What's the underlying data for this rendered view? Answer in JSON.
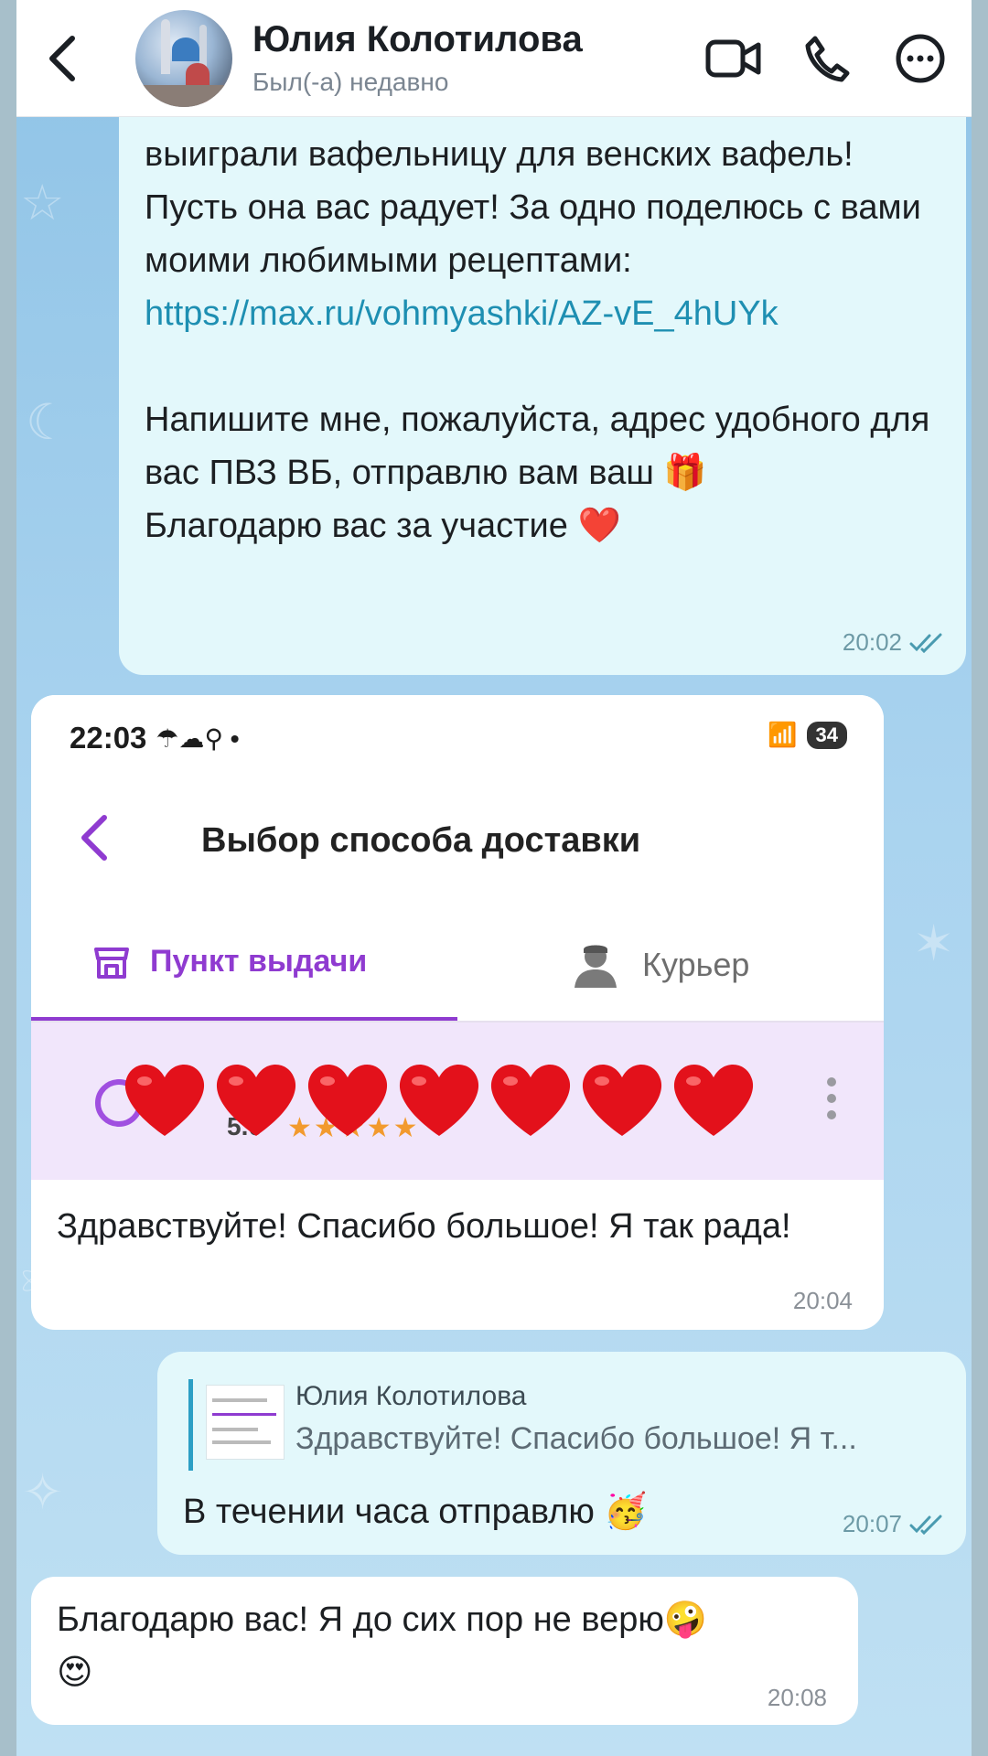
{
  "header": {
    "contact_name": "Юлия Колотилова",
    "status": "Был(-а) недавно"
  },
  "messages": {
    "m1": {
      "text_before_link": "выиграли вафельницу для венских вафель! Пусть она вас радует! За одно поделюсь с вами моими любимыми рецептами: ",
      "link": "https://max.ru/vohmyashki/AZ-vE_4hUYk",
      "text_after": "\n\nНапишите мне, пожалуйста, адрес удобного для вас ПВЗ ВБ, отправлю вам ваш 🎁\nБлагодарю вас за участие ❤️",
      "time": "20:02"
    },
    "m2": {
      "screenshot": {
        "status_time": "22:03",
        "battery": "34",
        "title": "Выбор способа доставки",
        "tab_pickup": "Пункт выдачи",
        "tab_courier": "Курьер",
        "rating": "5.0",
        "stars": "★★★★★"
      },
      "text": "Здравствуйте! Спасибо большое! Я так рада!",
      "time": "20:04"
    },
    "m3": {
      "reply_name": "Юлия Колотилова",
      "reply_text": "Здравствуйте! Спасибо большое! Я т...",
      "text": "В течении часа отправлю 🥳",
      "time": "20:07"
    },
    "m4": {
      "text": "Благодарю вас! Я до сих пор не верю🤪\n😍",
      "time": "20:08"
    }
  },
  "colors": {
    "accent_purple": "#8f3bd0",
    "link_blue": "#1e8fb2",
    "outgoing_bubble": "#e3f8fb",
    "chat_background": "#a9d3ef"
  },
  "icons": [
    "back-arrow-icon",
    "video-call-icon",
    "phone-icon",
    "more-icon",
    "double-check-icon",
    "heart-icon"
  ]
}
